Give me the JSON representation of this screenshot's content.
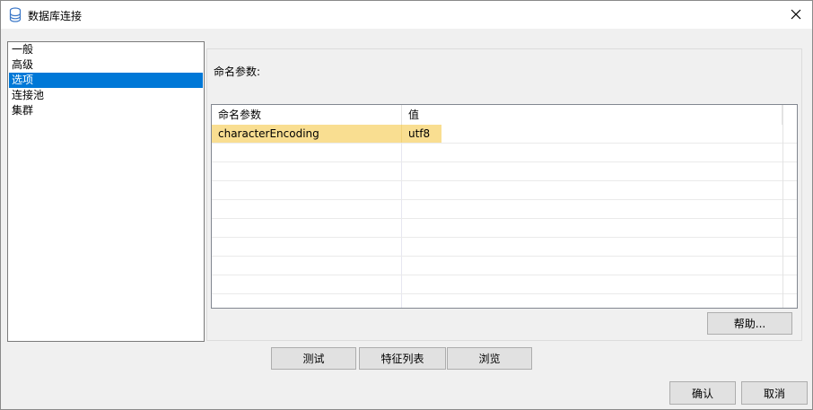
{
  "window": {
    "title": "数据库连接",
    "icon": "database-icon",
    "close_icon": "close-icon"
  },
  "nav": {
    "items": [
      {
        "label": "一般",
        "selected": false
      },
      {
        "label": "高级",
        "selected": false
      },
      {
        "label": "选项",
        "selected": true
      },
      {
        "label": "连接池",
        "selected": false
      },
      {
        "label": "集群",
        "selected": false
      }
    ]
  },
  "options": {
    "params_label": "命名参数:",
    "table": {
      "columns": [
        "命名参数",
        "值"
      ],
      "rows": [
        {
          "name": "characterEncoding",
          "value": "utf8"
        }
      ]
    },
    "help_button": "帮助..."
  },
  "actions": {
    "test": "测试",
    "feature_list": "特征列表",
    "browse": "浏览",
    "ok": "确认",
    "cancel": "取消"
  },
  "colors": {
    "selection": "#0078d7",
    "row_highlight": "#f9de91"
  }
}
